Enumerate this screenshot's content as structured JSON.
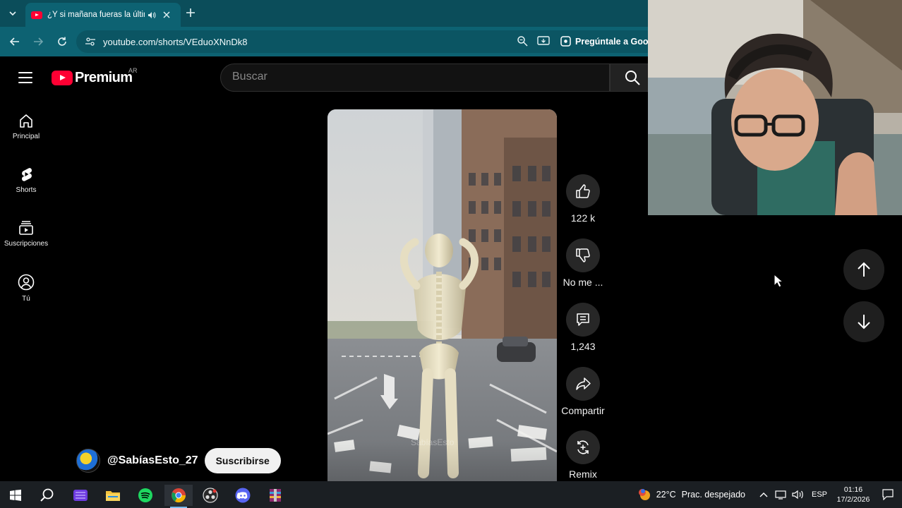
{
  "browser": {
    "tab_title": "¿Y si mañana fueras la última",
    "url": "youtube.com/shorts/VEduoXNnDk8",
    "gemini_label": "Pregúntale a Goog"
  },
  "youtube": {
    "logo_text": "Premium",
    "country": "AR",
    "search_placeholder": "Buscar",
    "guide": [
      {
        "label": "Principal",
        "icon": "home-icon"
      },
      {
        "label": "Shorts",
        "icon": "shorts-icon"
      },
      {
        "label": "Suscripciones",
        "icon": "subscriptions-icon"
      },
      {
        "label": "Tú",
        "icon": "you-icon"
      }
    ],
    "actions": {
      "like": "122 k",
      "dislike": "No me ...",
      "comments": "1,243",
      "share": "Compartir",
      "remix": "Remix"
    },
    "channel": {
      "name": "@SabíasEsto_27",
      "subscribe_label": "Suscribirse"
    },
    "video_watermark": "SabíasEsto"
  },
  "taskbar": {
    "weather_temp": "22°C",
    "weather_desc": "Prac. despejado",
    "language": "ESP",
    "time": "01:16",
    "date": "17/2/2026"
  },
  "colors": {
    "tab_bar": "#0b4d5a",
    "address_bar": "#0d6272",
    "youtube_red": "#ff0033",
    "taskbar": "#1b1f23"
  }
}
